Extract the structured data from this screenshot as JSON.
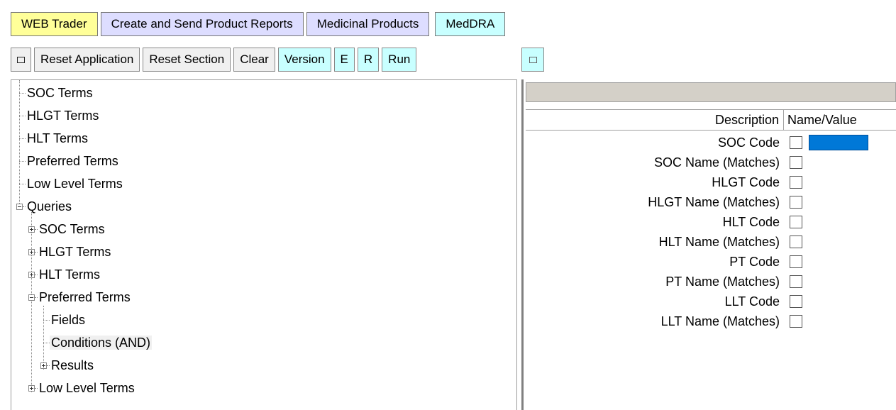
{
  "tabs": [
    {
      "label": "WEB Trader"
    },
    {
      "label": "Create and Send Product Reports"
    },
    {
      "label": "Medicinal Products"
    },
    {
      "label": "MedDRA"
    }
  ],
  "toolbar": {
    "reset_application": "Reset Application",
    "reset_section": "Reset Section",
    "clear": "Clear",
    "version": "Version",
    "e": "E",
    "r": "R",
    "run": "Run"
  },
  "tree": {
    "soc_terms": "SOC Terms",
    "hlgt_terms": "HLGT Terms",
    "hlt_terms": "HLT Terms",
    "preferred_terms": "Preferred Terms",
    "low_level_terms": "Low Level Terms",
    "queries": "Queries",
    "q_soc_terms": "SOC Terms",
    "q_hlgt_terms": "HLGT Terms",
    "q_hlt_terms": "HLT Terms",
    "q_preferred_terms": "Preferred Terms",
    "fields": "Fields",
    "conditions": "Conditions (AND)",
    "results": "Results",
    "q_low_level_terms": "Low Level Terms"
  },
  "grid": {
    "header_description": "Description",
    "header_name_value": "Name/Value",
    "rows": [
      {
        "label": "SOC Code",
        "checked": false
      },
      {
        "label": "SOC Name (Matches)",
        "checked": false
      },
      {
        "label": "HLGT Code",
        "checked": false
      },
      {
        "label": "HLGT Name (Matches)",
        "checked": false
      },
      {
        "label": "HLT Code",
        "checked": false
      },
      {
        "label": "HLT Name (Matches)",
        "checked": false
      },
      {
        "label": "PT Code",
        "checked": false
      },
      {
        "label": "PT Name (Matches)",
        "checked": false
      },
      {
        "label": "LLT Code",
        "checked": false
      },
      {
        "label": "LLT Name (Matches)",
        "checked": false
      }
    ]
  },
  "colors": {
    "tab_web": "#ffff99",
    "tab_lavender": "#ddddff",
    "tab_cyan": "#c8ffff",
    "active_value": "#0078d7"
  }
}
